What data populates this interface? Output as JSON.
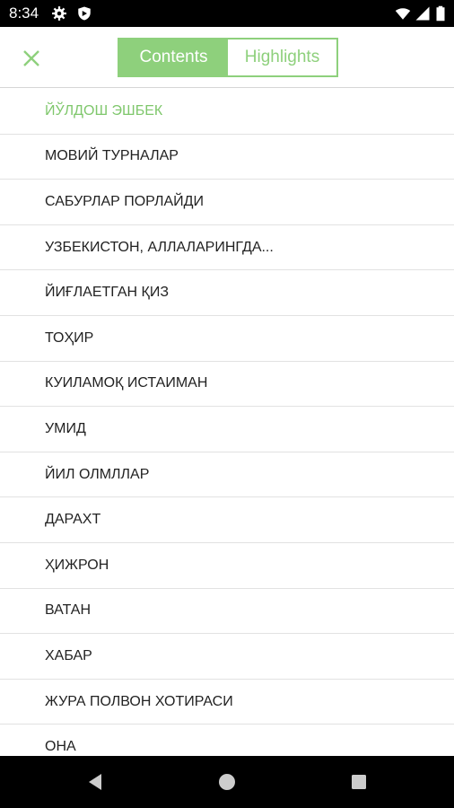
{
  "status_bar": {
    "time": "8:34",
    "icons": [
      "gear-icon",
      "shield-icon",
      "wifi-icon",
      "signal-icon",
      "battery-icon"
    ]
  },
  "toolbar": {
    "close_icon": "close-icon",
    "tabs": [
      {
        "label": "Contents",
        "selected": true
      },
      {
        "label": "Highlights",
        "selected": false
      }
    ]
  },
  "colors": {
    "accent": "#8ed07c",
    "current_item": "#7fc76c",
    "text": "#222222"
  },
  "contents": {
    "items": [
      {
        "label": "ЙЎЛДОШ ЭШБЕК",
        "current": true
      },
      {
        "label": "МОВИЙ ТУРНАЛАР"
      },
      {
        "label": "САБУРЛАР ПОРЛАЙДИ"
      },
      {
        "label": "УЗБЕКИСТОН, АЛЛАЛАРИНГДА..."
      },
      {
        "label": "ЙИҒЛАЕТГАН ҚИЗ"
      },
      {
        "label": "ТОҲИР"
      },
      {
        "label": "КУИЛАМОҚ ИСТАИМАН"
      },
      {
        "label": "УМИД"
      },
      {
        "label": "ЙИЛ ОЛМЛЛАР"
      },
      {
        "label": "ДАРАХТ"
      },
      {
        "label": "ҲИЖРОН"
      },
      {
        "label": "ВАТАН"
      },
      {
        "label": "ХАБАР"
      },
      {
        "label": "ЖУРА ПОЛВОН ХОТИРАСИ"
      },
      {
        "label": "ОНА"
      }
    ]
  },
  "nav_bar": {
    "buttons": [
      "back-icon",
      "home-icon",
      "recents-icon"
    ]
  }
}
